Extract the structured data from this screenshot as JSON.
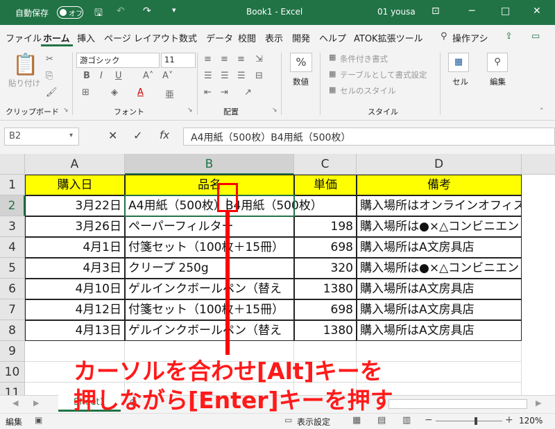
{
  "titlebar": {
    "autosave_label": "自動保存",
    "autosave_state": "オフ",
    "book_title": "Book1 - Excel",
    "user": "01 yousa"
  },
  "tabs": [
    "ファイル",
    "ホーム",
    "挿入",
    "ページ レイアウト",
    "数式",
    "データ",
    "校閲",
    "表示",
    "開発",
    "ヘルプ",
    "ATOK拡張ツール"
  ],
  "tell_me": "操作アシ",
  "ribbon": {
    "paste_label": "貼り付け",
    "clipboard_label": "クリップボード",
    "font_name": "游ゴシック",
    "font_size": "11",
    "font_group_label": "フォント",
    "align_group_label": "配置",
    "number_label": "数値",
    "conditional_format": "条件付き書式",
    "table_format": "テーブルとして書式設定",
    "cell_styles": "セルのスタイル",
    "style_group_label": "スタイル",
    "cells_label": "セル",
    "edit_label": "編集"
  },
  "formula_bar": {
    "name_box": "B2",
    "content": "A4用紙（500枚）B4用紙（500枚）"
  },
  "columns": [
    "A",
    "B",
    "C",
    "D"
  ],
  "rows": [
    {
      "n": "1",
      "a": "購入日",
      "b": "品名",
      "c": "単価",
      "d": "備考",
      "header": true
    },
    {
      "n": "2",
      "a": "3月22日",
      "b": "A4用紙（500枚）B4用紙（500枚）",
      "c": "",
      "d": "購入場所はオンラインオフィス"
    },
    {
      "n": "3",
      "a": "3月26日",
      "b": "ペーパーフィルター",
      "c": "198",
      "d": "購入場所は●×△コンビニエン"
    },
    {
      "n": "4",
      "a": "4月1日",
      "b": "付箋セット（100枚＋15冊）",
      "c": "698",
      "d": "購入場所はA文房具店"
    },
    {
      "n": "5",
      "a": "4月3日",
      "b": "クリープ 250g",
      "c": "320",
      "d": "購入場所は●×△コンビニエン"
    },
    {
      "n": "6",
      "a": "4月10日",
      "b": "ゲルインクボールペン（替え",
      "c": "1380",
      "d": "購入場所はA文房具店"
    },
    {
      "n": "7",
      "a": "4月12日",
      "b": "付箋セット（100枚＋15冊）",
      "c": "698",
      "d": "購入場所はA文房具店"
    },
    {
      "n": "8",
      "a": "4月13日",
      "b": "ゲルインクボールペン（替え",
      "c": "1380",
      "d": "購入場所はA文房具店"
    },
    {
      "n": "9",
      "a": "",
      "b": "",
      "c": "",
      "d": ""
    },
    {
      "n": "10",
      "a": "",
      "b": "",
      "c": "",
      "d": ""
    },
    {
      "n": "11",
      "a": "",
      "b": "",
      "c": "",
      "d": ""
    }
  ],
  "sheet_tab": "Sheet1",
  "status": {
    "mode": "編集",
    "display_settings": "表示設定",
    "zoom": "120%"
  },
  "annotation": {
    "line1": "カーソルを合わせ[Alt]キーを",
    "line2": "押しながら[Enter]キーを押す"
  },
  "colors": {
    "excel_green": "#217346",
    "header_fill": "#ffff00",
    "annotation": "#ff0000"
  }
}
